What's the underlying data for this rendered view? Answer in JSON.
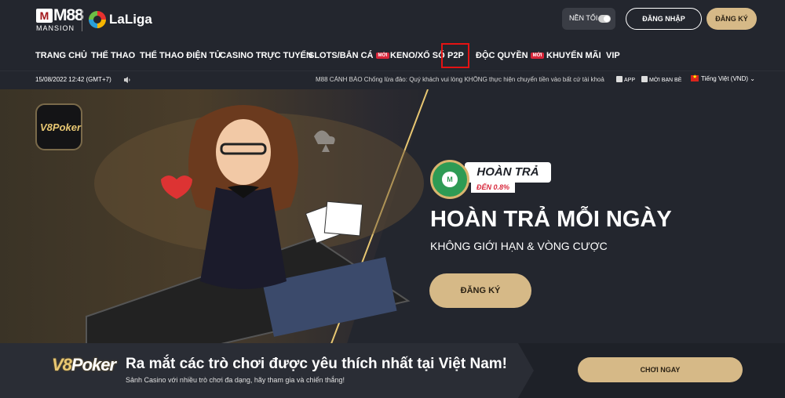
{
  "header": {
    "logo_brand": "M88",
    "logo_badge": "M",
    "logo_sub": "MANSION",
    "partner": "LaLiga",
    "dark_mode_label": "NỀN TỐI",
    "login_label": "ĐĂNG NHẬP",
    "register_label": "ĐĂNG KÝ"
  },
  "nav": {
    "items": [
      {
        "label": "TRANG CHỦ"
      },
      {
        "label": "THỂ THAO"
      },
      {
        "label": "THỂ THAO ĐIỆN TỬ"
      },
      {
        "label": "CASINO TRỰC TUYẾN"
      },
      {
        "label": "SLOTS/BẮN CÁ",
        "badge": "MỚI"
      },
      {
        "label": "KENO/XỔ SỐ"
      },
      {
        "label": "P2P",
        "highlighted": true
      },
      {
        "label": "ĐỘC QUYỀN",
        "badge": "MỚI"
      },
      {
        "label": "KHUYẾN MÃI"
      },
      {
        "label": "VIP"
      }
    ]
  },
  "infobar": {
    "datetime": "15/08/2022 12:42 (GMT+7)",
    "announcement": "M88 CẢNH BÁO Chống lừa đảo: Quý khách vui lòng KHÔNG thực hiện chuyển tiền vào bất cứ tài khoả",
    "app_label": "APP",
    "invite_label": "MỜI BẠN BÈ",
    "language": "Tiếng Việt (VND)"
  },
  "hero": {
    "game_logo": "V8Poker",
    "badge_title": "HOÀN TRẢ",
    "badge_rate": "ĐẾN 0.8%",
    "title": "HOÀN TRẢ MỖI NGÀY",
    "subtitle": "KHÔNG GIỚI HẠN & VÒNG CƯỢC",
    "cta_label": "ĐĂNG KÝ"
  },
  "promo": {
    "logo_v8": "V8",
    "logo_poker": "Poker",
    "title": "Ra mắt các trò chơi được yêu thích nhất tại Việt Nam!",
    "subtitle": "Sảnh Casino với nhiều trò chơi đa dạng, hãy tham gia và chiến thắng!",
    "cta_label": "CHƠI NGAY"
  },
  "colors": {
    "header_bg": "#23262e",
    "gold_accent": "#d6b987",
    "badge_red": "#d8263a",
    "highlight_box": "#e41313"
  }
}
